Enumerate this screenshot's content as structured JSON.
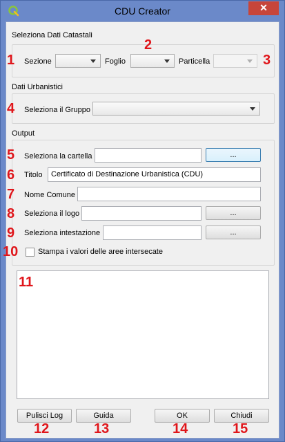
{
  "window": {
    "title": "CDU Creator",
    "close_glyph": "✕"
  },
  "catastali": {
    "heading": "Seleziona Dati Catastali",
    "sezione_label": "Sezione",
    "foglio_label": "Foglio",
    "particella_label": "Particella"
  },
  "urbanistici": {
    "heading": "Dati Urbanistici",
    "gruppo_label": "Seleziona il Gruppo"
  },
  "output": {
    "heading": "Output",
    "cartella_label": "Seleziona la cartella",
    "cartella_value": "",
    "browse_label": "...",
    "titolo_label": "Titolo",
    "titolo_value": "Certificato di Destinazione Urbanistica (CDU)",
    "comune_label": "Nome Comune",
    "comune_value": "",
    "logo_label": "Seleziona il logo",
    "logo_value": "",
    "intestazione_label": "Seleziona intestazione",
    "intestazione_value": "",
    "stampa_label": "Stampa i valori delle aree intersecate",
    "stampa_checked": false
  },
  "buttons": {
    "pulisci": "Pulisci Log",
    "guida": "Guida",
    "ok": "OK",
    "chiudi": "Chiudi"
  },
  "annotations": [
    "1",
    "2",
    "3",
    "4",
    "5",
    "6",
    "7",
    "8",
    "9",
    "10",
    "11",
    "12",
    "13",
    "14",
    "15"
  ],
  "colors": {
    "titlebar": "#6b89c9",
    "close": "#c7453a",
    "annotation": "#e0161b",
    "dialog_bg": "#f0f0f0"
  }
}
